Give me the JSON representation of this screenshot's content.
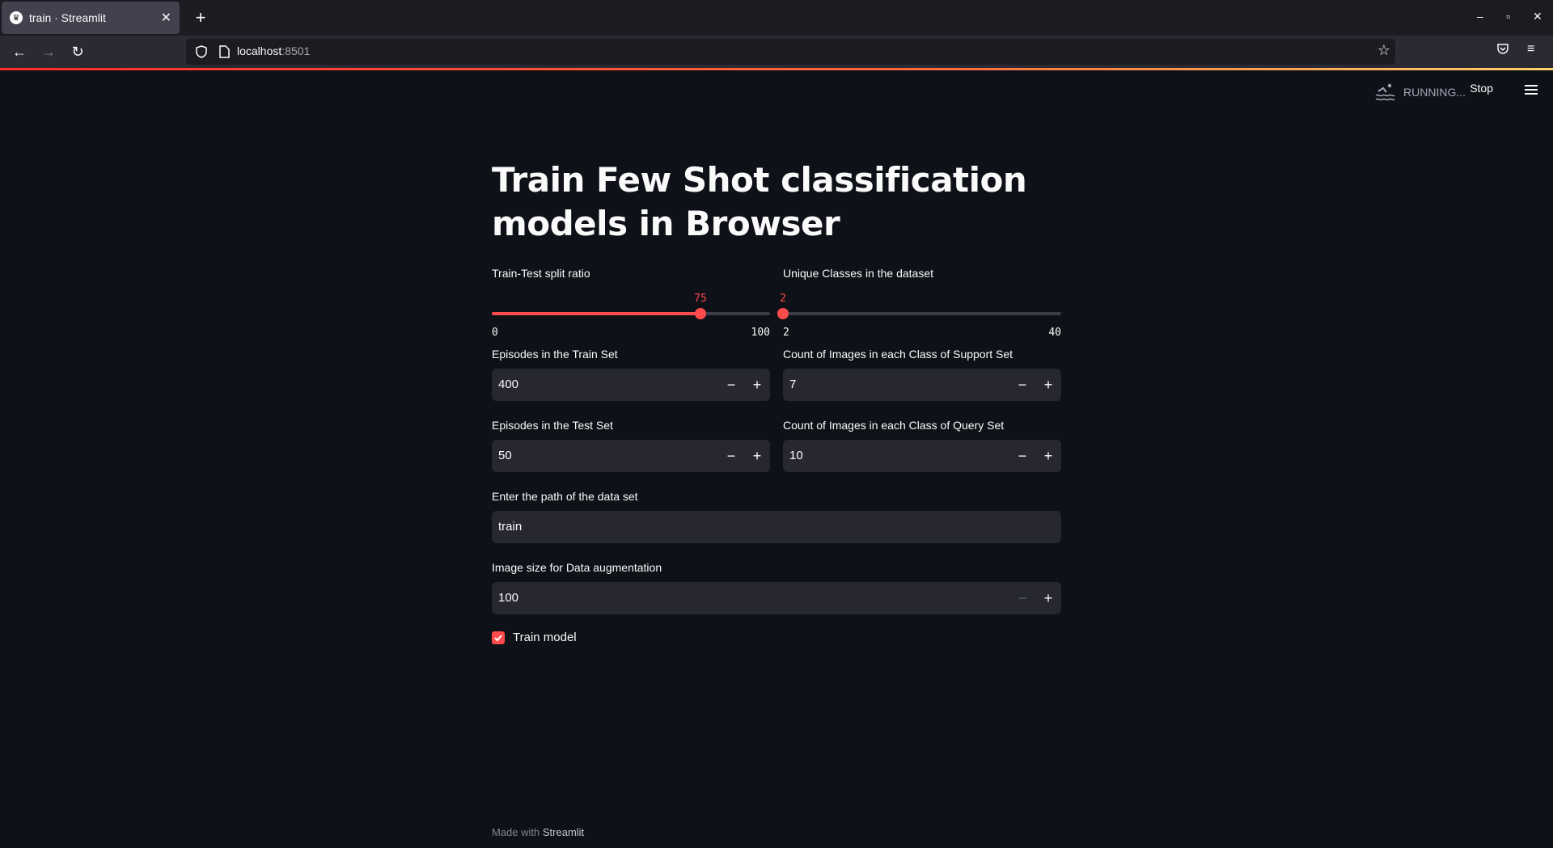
{
  "browser": {
    "tab_title": "train · Streamlit",
    "url_host": "localhost",
    "url_port": ":8501"
  },
  "streamlit_header": {
    "status": "RUNNING...",
    "stop_label": "Stop"
  },
  "main": {
    "title": "Train Few Shot classification models in Browser",
    "split_slider": {
      "label": "Train-Test split ratio",
      "value": "75",
      "min": "0",
      "max": "100",
      "fraction": 0.75
    },
    "classes_slider": {
      "label": "Unique Classes in the dataset",
      "value": "2",
      "min": "2",
      "max": "40",
      "fraction": 0.0
    },
    "train_episodes": {
      "label": "Episodes in the Train Set",
      "value": "400"
    },
    "support_count": {
      "label": "Count of Images in each Class of Support Set",
      "value": "7"
    },
    "test_episodes": {
      "label": "Episodes in the Test Set",
      "value": "50"
    },
    "query_count": {
      "label": "Count of Images in each Class of Query Set",
      "value": "10"
    },
    "dataset_path": {
      "label": "Enter the path of the data set",
      "value": "train"
    },
    "image_size": {
      "label": "Image size for Data augmentation",
      "value": "100"
    },
    "train_checkbox": {
      "label": "Train model",
      "checked": true
    }
  },
  "footer": {
    "prefix": "Made with",
    "brand": "Streamlit"
  },
  "colors": {
    "accent": "#ff4b4b",
    "background": "#0e1117",
    "input_bg": "#262730"
  }
}
